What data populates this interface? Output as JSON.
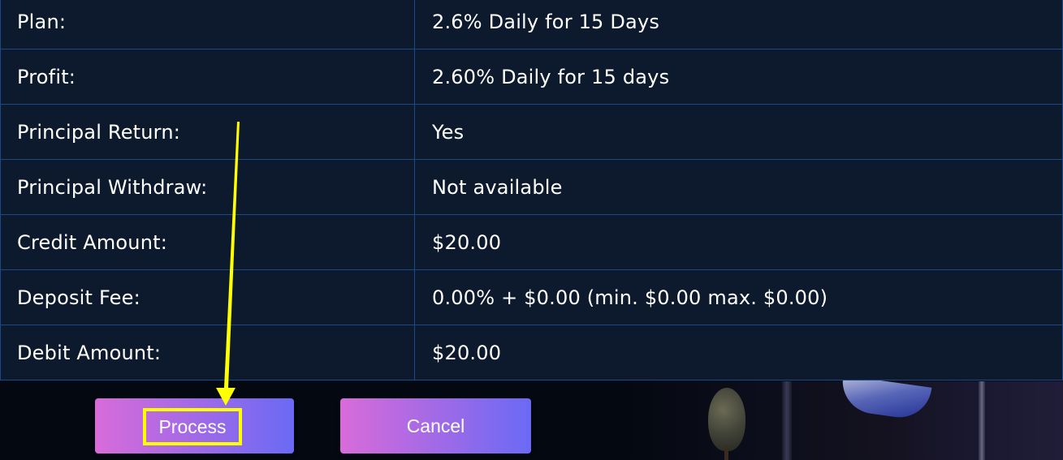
{
  "details": {
    "rows": [
      {
        "label": "Plan:",
        "value": "2.6% Daily for 15 Days"
      },
      {
        "label": "Profit:",
        "value": "2.60% Daily for 15 days"
      },
      {
        "label": "Principal Return:",
        "value": "Yes"
      },
      {
        "label": "Principal Withdraw:",
        "value": "Not available"
      },
      {
        "label": "Credit Amount:",
        "value": "$20.00"
      },
      {
        "label": "Deposit Fee:",
        "value": "0.00% + $0.00 (min. $0.00 max. $0.00)"
      },
      {
        "label": "Debit Amount:",
        "value": "$20.00"
      }
    ]
  },
  "actions": {
    "process_label": "Process",
    "cancel_label": "Cancel"
  },
  "colors": {
    "table_bg": "#0d1a2e",
    "table_border": "#1d4a86",
    "button_gradient_start": "#d96bd9",
    "button_gradient_end": "#6a6af5",
    "annotation": "#ffff00"
  },
  "annotation": {
    "icon": "arrow-down-icon"
  }
}
